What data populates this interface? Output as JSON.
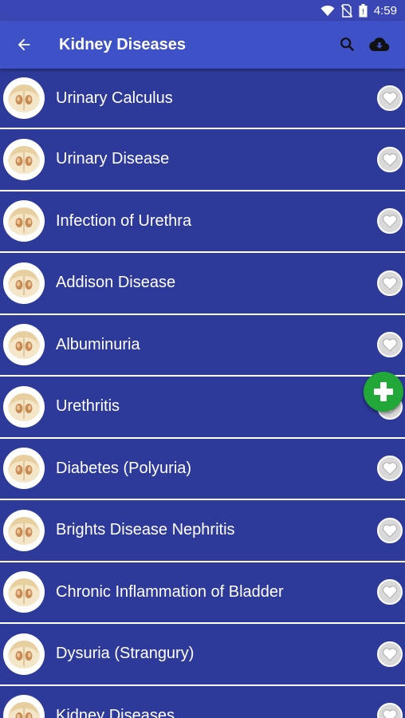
{
  "status_bar": {
    "time": "4:59",
    "icons": [
      "wifi-icon",
      "no-sim-icon",
      "battery-icon"
    ]
  },
  "app_bar": {
    "title": "Kidney Diseases",
    "back_icon": "arrow-back-icon",
    "actions": [
      "search-icon",
      "cloud-download-icon"
    ]
  },
  "list": {
    "items": [
      {
        "label": "Urinary Calculus"
      },
      {
        "label": "Urinary Disease"
      },
      {
        "label": "Infection of Urethra"
      },
      {
        "label": "Addison Disease"
      },
      {
        "label": "Albuminuria"
      },
      {
        "label": "Urethritis"
      },
      {
        "label": "Diabetes (Polyuria)"
      },
      {
        "label": "Brights Disease Nephritis"
      },
      {
        "label": "Chronic Inflammation of Bladder"
      },
      {
        "label": "Dysuria (Strangury)"
      },
      {
        "label": "Kidney Diseases"
      }
    ],
    "item_icon": "kidney-illustration",
    "favorite_icon": "heart-outline-icon"
  },
  "fab": {
    "icon": "plus-icon"
  },
  "colors": {
    "primary": "#3f51c6",
    "list_background": "#2e3a9a",
    "fab": "#22a838"
  }
}
